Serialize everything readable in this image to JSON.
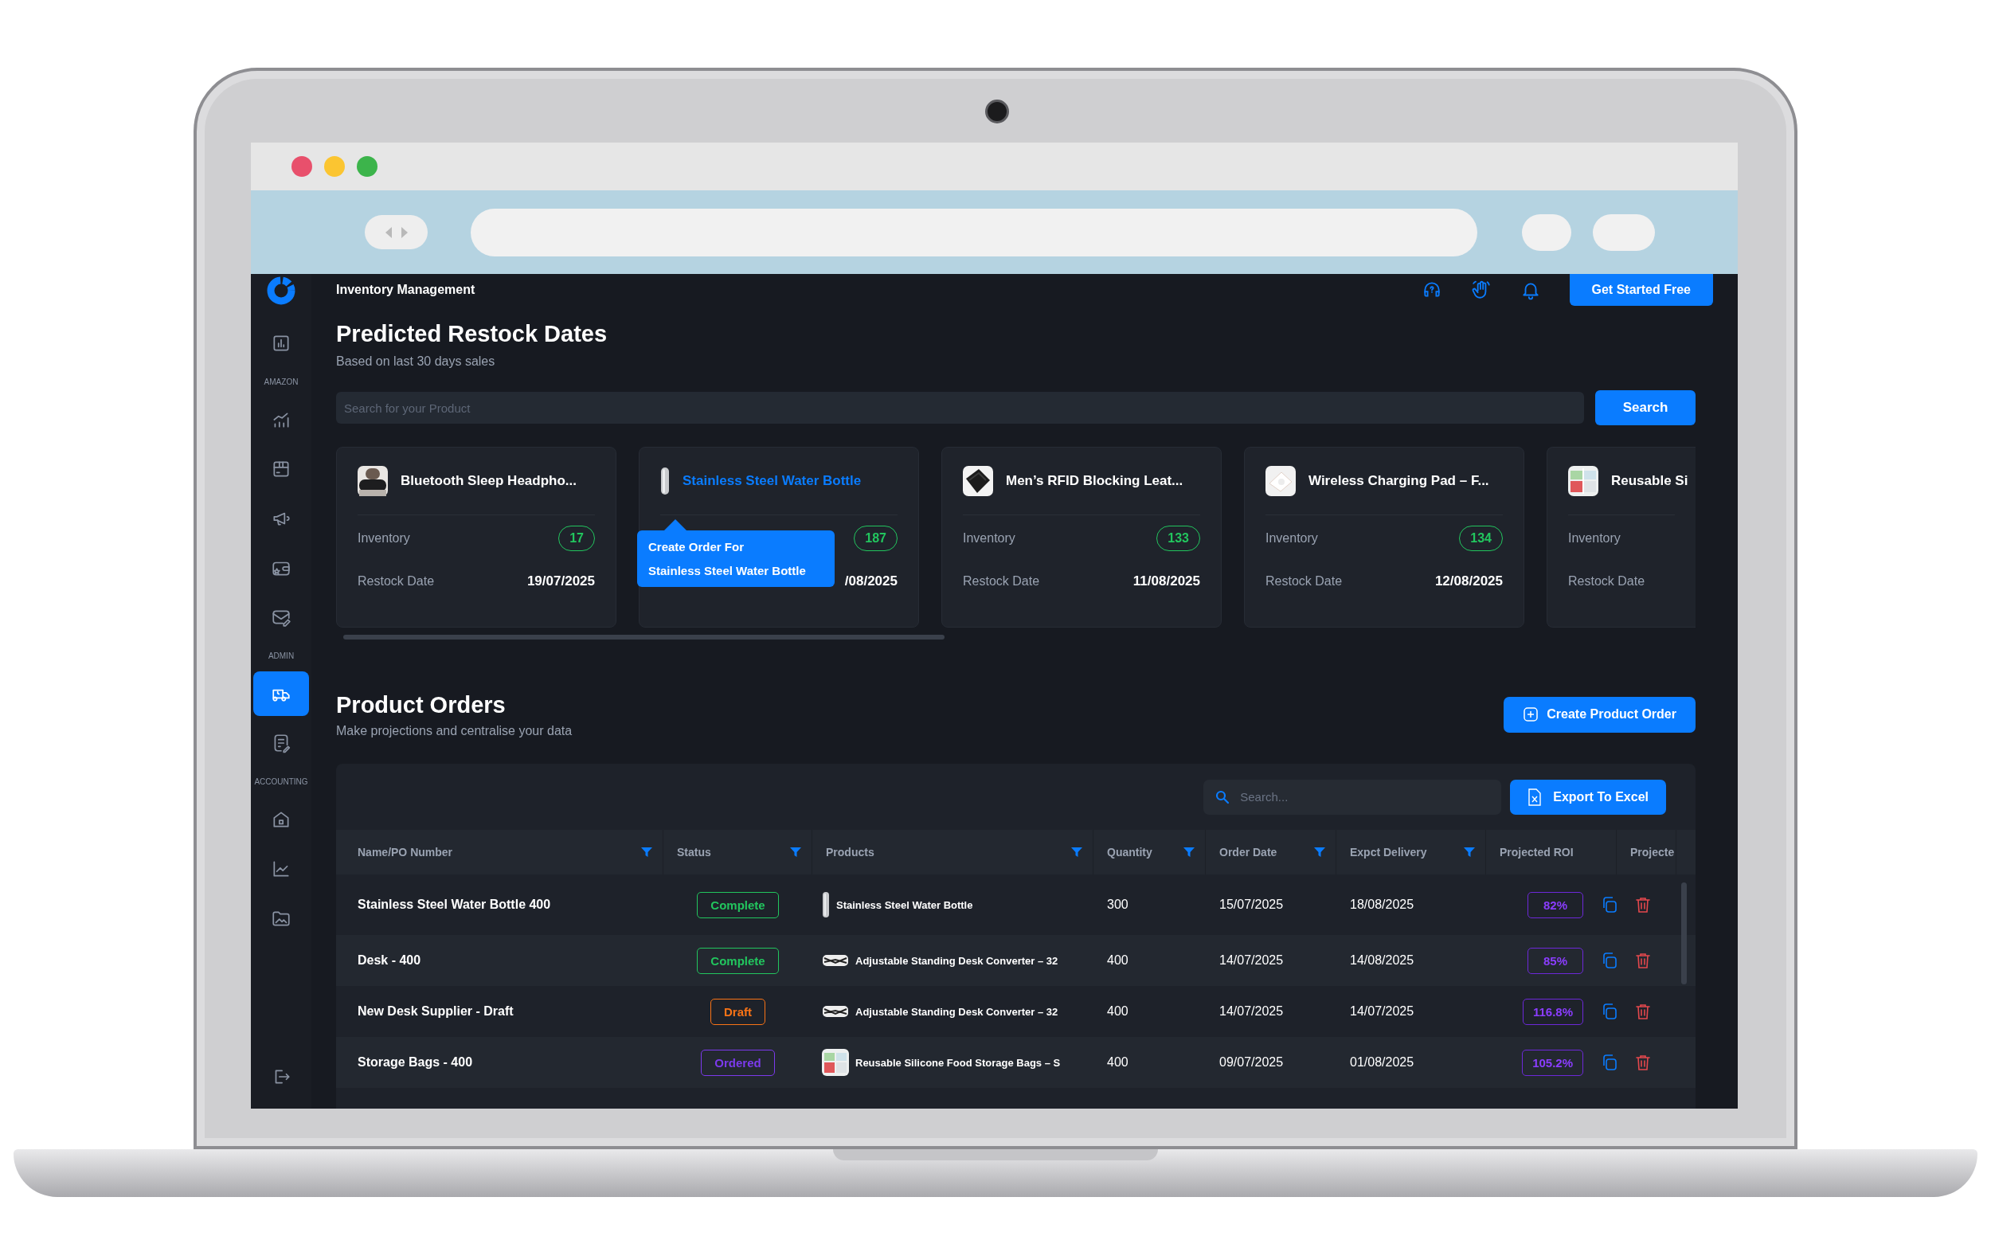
{
  "header": {
    "title": "Inventory Management",
    "cta": "Get Started Free"
  },
  "sidebar": {
    "items": [
      {
        "kind": "link",
        "selected": false
      },
      {
        "kind": "heading",
        "label": "AMAZON"
      },
      {
        "kind": "link",
        "selected": false
      },
      {
        "kind": "link",
        "selected": false
      },
      {
        "kind": "link",
        "selected": false
      },
      {
        "kind": "link",
        "selected": false
      },
      {
        "kind": "link",
        "selected": false
      },
      {
        "kind": "heading",
        "label": "ADMIN"
      },
      {
        "kind": "link",
        "selected": true
      },
      {
        "kind": "link",
        "selected": false
      },
      {
        "kind": "heading",
        "label": "ACCOUNTING"
      },
      {
        "kind": "link",
        "selected": false
      },
      {
        "kind": "link",
        "selected": false
      },
      {
        "kind": "link",
        "selected": false
      }
    ]
  },
  "restock": {
    "title": "Predicted Restock Dates",
    "subtitle": "Based on last 30 days sales",
    "search": {
      "placeholder": "Search for your Product"
    },
    "search_button": "Search",
    "cards": [
      {
        "name": "Bluetooth Sleep Headpho...",
        "hovered": false,
        "inventory_label": "Inventory",
        "inventory": "17",
        "restock_label": "Restock Date",
        "restock_date": "19/07/2025"
      },
      {
        "name": "Stainless Steel Water Bottle",
        "hovered": true,
        "tooltip": [
          "Create Order For",
          "Stainless Steel Water Bottle"
        ],
        "inventory": "187",
        "restock_date": "/08/2025"
      },
      {
        "name": "Men’s RFID Blocking Leat...",
        "hovered": false,
        "inventory_label": "Inventory",
        "inventory": "133",
        "restock_label": "Restock Date",
        "restock_date": "11/08/2025"
      },
      {
        "name": "Wireless Charging Pad – F...",
        "hovered": false,
        "inventory_label": "Inventory",
        "inventory": "134",
        "restock_label": "Restock Date",
        "restock_date": "12/08/2025"
      },
      {
        "name": "Reusable Si",
        "hovered": false,
        "inventory_label": "Inventory",
        "restock_label": "Restock Date"
      }
    ]
  },
  "orders": {
    "title": "Product Orders",
    "subtitle": "Make projections and centralise your data",
    "create_button": "Create Product Order",
    "search": {
      "placeholder": "Search..."
    },
    "export_button": "Export To Excel",
    "columns": [
      {
        "label": "Name/PO Number",
        "filter": true
      },
      {
        "label": "Status",
        "filter": true
      },
      {
        "label": "Products",
        "filter": true
      },
      {
        "label": "Quantity",
        "filter": true
      },
      {
        "label": "Order Date",
        "filter": true
      },
      {
        "label": "Expct Delivery",
        "filter": true
      },
      {
        "label": "Projected ROI",
        "filter": false
      },
      {
        "label": "Projecte",
        "filter": false
      }
    ],
    "rows": [
      {
        "name": "Stainless Steel Water Bottle 400",
        "status": {
          "label": "Complete",
          "color": "#22c55e"
        },
        "product": "Stainless Steel Water Bottle",
        "quantity": "300",
        "order_date": "15/07/2025",
        "delivery": "18/08/2025",
        "roi": "82%"
      },
      {
        "name": "Desk - 400",
        "status": {
          "label": "Complete",
          "color": "#22c55e"
        },
        "product": "Adjustable Standing Desk Converter – 32",
        "quantity": "400",
        "order_date": "14/07/2025",
        "delivery": "14/08/2025",
        "roi": "85%"
      },
      {
        "name": "New Desk Supplier - Draft",
        "status": {
          "label": "Draft",
          "color": "#f97316"
        },
        "product": "Adjustable Standing Desk Converter – 32",
        "quantity": "400",
        "order_date": "14/07/2025",
        "delivery": "14/07/2025",
        "roi": "116.8%"
      },
      {
        "name": "Storage Bags - 400",
        "status": {
          "label": "Ordered",
          "color": "#7c3aed"
        },
        "product": "Reusable Silicone Food Storage Bags – S",
        "quantity": "400",
        "order_date": "09/07/2025",
        "delivery": "01/08/2025",
        "roi": "105.2%"
      }
    ]
  }
}
